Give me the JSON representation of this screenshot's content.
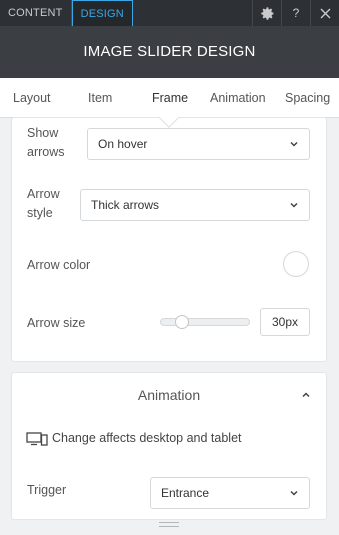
{
  "topbar": {
    "tabs": [
      "CONTENT",
      "DESIGN"
    ],
    "icons": [
      "gear-icon",
      "help-icon",
      "close-icon"
    ],
    "help_label": "?"
  },
  "header": {
    "title": "IMAGE SLIDER DESIGN"
  },
  "subtabs": [
    {
      "label": "Layout",
      "active": false
    },
    {
      "label": "Item",
      "active": false
    },
    {
      "label": "Frame",
      "active": true
    },
    {
      "label": "Animation",
      "active": false
    },
    {
      "label": "Spacing",
      "active": false
    }
  ],
  "frame": {
    "show_arrows": {
      "label_line1": "Show",
      "label_line2": "arrows",
      "value": "On hover"
    },
    "arrow_style": {
      "label_line1": "Arrow",
      "label_line2": "style",
      "value": "Thick arrows"
    },
    "arrow_color": {
      "label": "Arrow color",
      "value": "#ffffff"
    },
    "arrow_size": {
      "label": "Arrow size",
      "value": "30px",
      "slider_fraction": 0.2
    }
  },
  "animation": {
    "title": "Animation",
    "device_note": "Change affects desktop and tablet",
    "trigger": {
      "label": "Trigger",
      "value": "Entrance"
    }
  },
  "colors": {
    "accent": "#3aa7e6",
    "topbar": "#2d3034",
    "header": "#3b3f43"
  }
}
